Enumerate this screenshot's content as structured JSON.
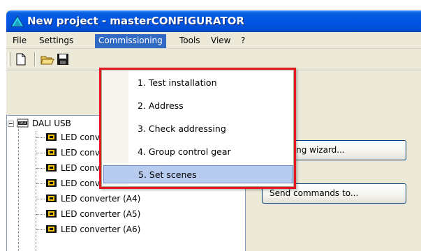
{
  "window": {
    "title": "New project - masterCONFIGURATOR"
  },
  "menu": [
    {
      "label": "File"
    },
    {
      "label": "Settings"
    },
    {
      "label": "Commissioning"
    },
    {
      "label": "Tools"
    },
    {
      "label": "View"
    },
    {
      "label": "?"
    }
  ],
  "toolbar": {
    "icons": [
      "new-document-icon",
      "open-folder-icon",
      "save-icon"
    ]
  },
  "commissioning_menu": {
    "items": [
      {
        "label": "1. Test installation"
      },
      {
        "label": "2. Address"
      },
      {
        "label": "3. Check addressing"
      },
      {
        "label": "4. Group control gear"
      },
      {
        "label": "5. Set scenes"
      }
    ],
    "selected": "5. Set scenes",
    "highlight_color": "#e3191f"
  },
  "tree": {
    "root": "DALI USB",
    "items": [
      {
        "label": "LED converter (A0)"
      },
      {
        "label": "LED converter (A1)"
      },
      {
        "label": "LED converter (A2)"
      },
      {
        "label": "LED converter (A3)"
      },
      {
        "label": "LED converter (A4)"
      },
      {
        "label": "LED converter (A5)"
      },
      {
        "label": "LED converter (A6)"
      }
    ]
  },
  "buttons": {
    "wizard": "Addressing wizard...",
    "send": "Send commands to..."
  },
  "colors": {
    "selection": "#316ac5",
    "titlebar": "#0054e3"
  }
}
